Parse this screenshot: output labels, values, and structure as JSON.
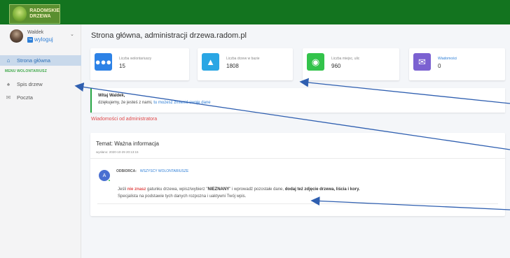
{
  "brand": {
    "line1": "RADOMSKIE",
    "line2": "DRZEWA"
  },
  "user": {
    "name": "Waldek",
    "logout": "wyloguj"
  },
  "sidebar": {
    "items": [
      {
        "label": "Strona główna",
        "icon": "home-icon"
      },
      {
        "label": "Spis drzew",
        "icon": "tree-icon"
      },
      {
        "label": "Poczta",
        "icon": "mail-icon"
      }
    ],
    "section_header": "MENU WOLONTARIUSZ"
  },
  "page": {
    "title": "Strona główna, administracji drzewa.radom.pl"
  },
  "stats": [
    {
      "label": "Liczba wolontariuszy",
      "value": "15",
      "icon": "users-icon",
      "color": "#2d82e6"
    },
    {
      "label": "Liczba drzew w bazie",
      "value": "1808",
      "icon": "tree-icon",
      "color": "#2aa6e4"
    },
    {
      "label": "Liczba miejsc, ulic",
      "value": "960",
      "icon": "globe-book-icon",
      "color": "#33c34b"
    },
    {
      "label": "Wiadomości",
      "value": "0",
      "icon": "envelope-icon",
      "color": "#7b61d1"
    }
  ],
  "welcome": {
    "name": "Witaj Waldek,",
    "text": "dziękujemy, że jesteś z nami,",
    "link": "tu możesz zmienić swoje dane"
  },
  "messages_title": "Wiadomości od administratora",
  "message": {
    "topic": "Temat: Ważna informacja",
    "date": "wysłano: 2020-10-29 20:13:15",
    "avatar_letter": "A",
    "recipient_label": "ODBIORCA:",
    "recipient_value": "WSZYSCY WOLONTARIUSZE",
    "body": {
      "p1": "Jeśli",
      "p2": "nie znasz",
      "p3": "gatunku drzewa, wpisz/wybierz \"",
      "p4": "NIEZNANY",
      "p5": "\" i wprowadź pozostałe dane,",
      "p6": "dodaj też zdjęcie drzewa, liścia i kory.",
      "line2": "Specjalista na podstawie tych danych rozpozna i uaktywni Twój wpis."
    }
  },
  "colors": {
    "topbar": "#13741f",
    "active_nav": "#c9d9eb",
    "accent_red": "#e04a4a",
    "link": "#2d7ed6",
    "arrow": "#2f5fb0"
  }
}
